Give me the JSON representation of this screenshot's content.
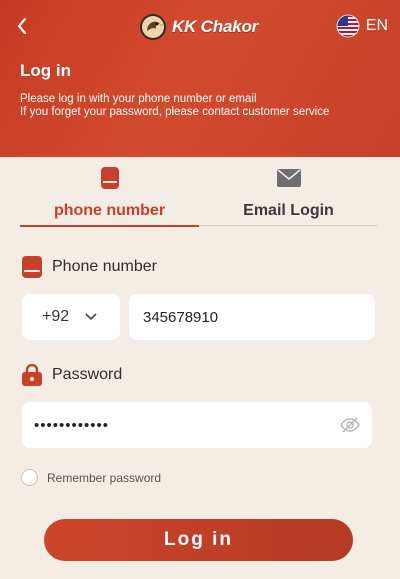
{
  "header": {
    "back_icon": "chevron-left-icon",
    "logo_text": "KK Chakor",
    "language": {
      "code": "EN",
      "flag_icon": "us-flag-icon"
    },
    "title": "Log in",
    "description_line1": "Please log in with your phone number or email",
    "description_line2": "If you forget your password, please contact customer service"
  },
  "tabs": [
    {
      "label": "phone number",
      "icon": "phone-icon",
      "active": true
    },
    {
      "label": "Email Login",
      "icon": "envelope-icon",
      "active": false
    }
  ],
  "phone": {
    "label": "Phone number",
    "country_code": "+92",
    "value": "345678910"
  },
  "password": {
    "label": "Password",
    "value": "••••••••••••"
  },
  "remember_label": "Remember password",
  "login_button": "Log in",
  "colors": {
    "accent": "#c9402a",
    "background": "#f3ede6",
    "header": "#c9402a"
  }
}
